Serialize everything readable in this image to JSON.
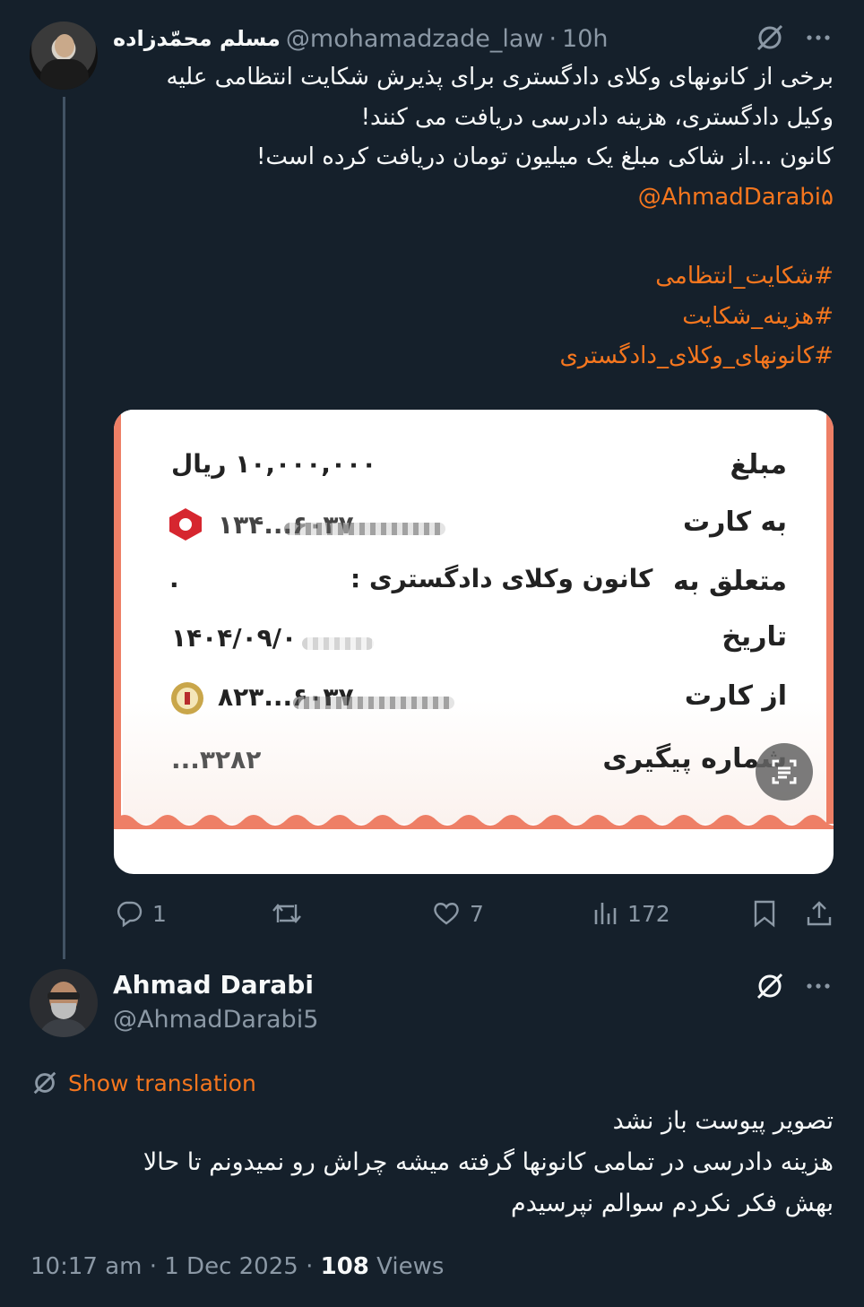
{
  "tweet1": {
    "author_name": "مسلم محمّدزاده",
    "handle": "@mohamadzade_law",
    "separator": "·",
    "time": "10h",
    "lines": [
      "برخی از کانونهای وکلای دادگستری برای پذیرش شکایت انتظامی علیه",
      "وکیل دادگستری، هزینه دادرسی دریافت می کنند!",
      "کانون ...از شاکی مبلغ یک میلیون تومان دریافت کرده است!"
    ],
    "mention": "@AhmadDarabi۵",
    "hashtags": [
      "#شکایت_انتظامی",
      "#هزینه_شکایت",
      "#کانونهای_وکلای_دادگستری"
    ],
    "receipt": {
      "amount_label": "مبلغ",
      "amount_value": "۱۰,۰۰۰,۰۰۰ ریال",
      "to_card_label": "به کارت",
      "to_card_value": "۶۰۳۷...۱۳۴",
      "belongs_label": "متعلق به",
      "belongs_value": "کانون وکلای دادگستری :",
      "belongs_dot": ".",
      "date_label": "تاریخ",
      "date_value": "۱۴۰۴/۰۹/۰",
      "from_card_label": "از کارت",
      "from_card_value": "۶۰۳۷...۸۲۳",
      "tracking_label": "شماره پیگیری",
      "tracking_value": "۳۲۸۲..."
    },
    "actions": {
      "replies": "1",
      "likes": "7",
      "views": "172"
    }
  },
  "tweet2": {
    "author_name": "Ahmad Darabi",
    "handle": "@AhmadDarabi5",
    "show_translation": "Show translation",
    "lines": [
      "تصویر پیوست باز نشد",
      "هزینه دادرسی در تمامی کانونها گرفته میشه چراش رو نمیدونم تا حالا",
      "بهش فکر نکردم سوالم نپرسیدم"
    ],
    "time": "10:17 am",
    "separator": "·",
    "date": "1 Dec 2025",
    "views_count": "108",
    "views_label": "Views"
  },
  "icons": [
    "grok-icon",
    "more-icon",
    "reply-icon",
    "retweet-icon",
    "like-icon",
    "views-icon",
    "bookmark-icon",
    "share-icon",
    "translate-icon",
    "lens-icon"
  ],
  "colors": {
    "background": "#15202b",
    "accent": "#f5761e",
    "muted": "#8b98a5",
    "text": "#f7f9f9"
  }
}
